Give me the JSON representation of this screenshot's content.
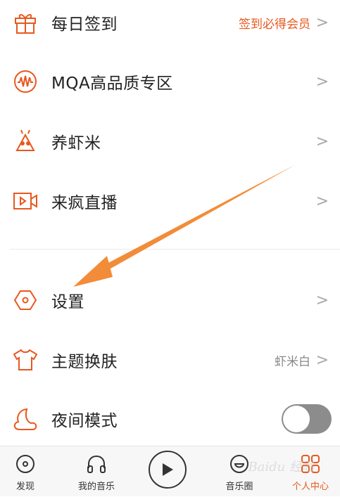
{
  "menu": {
    "items": [
      {
        "id": "daily-checkin",
        "label": "每日签到",
        "right_text": "签到必得会员",
        "chevron": ">"
      },
      {
        "id": "mqa",
        "label": "MQA高品质专区",
        "right_text": "",
        "chevron": ">"
      },
      {
        "id": "raise-xiami",
        "label": "养虾米",
        "right_text": "",
        "chevron": ">"
      },
      {
        "id": "live",
        "label": "来疯直播",
        "right_text": "",
        "chevron": ">"
      },
      {
        "id": "settings",
        "label": "设置",
        "right_text": "",
        "chevron": ">"
      },
      {
        "id": "theme",
        "label": "主题换肤",
        "right_text": "虾米白",
        "chevron": ">"
      },
      {
        "id": "night-mode",
        "label": "夜间模式",
        "toggle_on": false
      }
    ]
  },
  "tabbar": {
    "tabs": [
      {
        "id": "discover",
        "label": "发现"
      },
      {
        "id": "my-music",
        "label": "我的音乐"
      },
      {
        "id": "music-circle",
        "label": "音乐圈"
      },
      {
        "id": "profile",
        "label": "个人中心"
      }
    ]
  },
  "watermark": "Baidu 经验",
  "colors": {
    "accent": "#e8581e",
    "arrow": "#f28c38",
    "text": "#222222",
    "secondary": "#888888",
    "toggle_off": "#8c8c8c"
  }
}
